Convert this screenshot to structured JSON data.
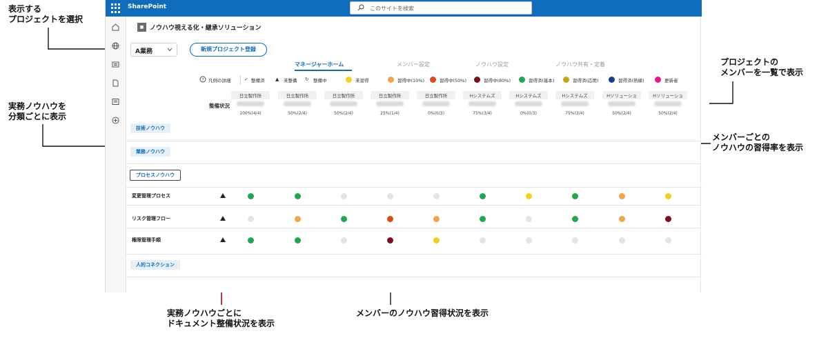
{
  "annotations": {
    "select_project": [
      "表示する",
      "プロジェクトを選択"
    ],
    "classify_knowhow": [
      "実務ノウハウを",
      "分類ごとに表示"
    ],
    "member_list": [
      "プロジェクトの",
      "メンバーを一覧で表示"
    ],
    "member_rate": [
      "メンバーごとの",
      "ノウハウの習得率を表示"
    ],
    "doc_status": [
      "実務ノウハウごとに",
      "ドキュメント整備状況を表示"
    ],
    "member_status": "メンバーのノウハウ習得状況を表示"
  },
  "app": {
    "brand": "SharePoint",
    "search_placeholder": "このサイトを検索",
    "site_title": "ノウハウ視える化・継承ソリューション",
    "site_logo": "■"
  },
  "toolbar": {
    "project_value": "A業務",
    "new_project_label": "新規プロジェクト登録"
  },
  "tabs": [
    {
      "label": "マネージャーホーム",
      "active": true
    },
    {
      "label": "メンバー設定",
      "active": false
    },
    {
      "label": "ノウハウ設定",
      "active": false
    },
    {
      "label": "ノウハウ共有・定着",
      "active": false
    }
  ],
  "legend": {
    "help_label": "凡例の詳細",
    "doc_items": [
      {
        "icon": "check-icon",
        "label": "整備済"
      },
      {
        "icon": "triangle-icon",
        "label": "未整備"
      },
      {
        "icon": "refresh-icon",
        "label": "整備中"
      }
    ],
    "skill_items": [
      {
        "label": "未習得",
        "color": "#f2d21b"
      },
      {
        "label": "習得中(10%)",
        "color": "#f5a34a"
      },
      {
        "label": "習得中(50%)",
        "color": "#d94a14"
      },
      {
        "label": "習得中(80%)",
        "color": "#7a0f23"
      },
      {
        "label": "習得済(基本)",
        "color": "#1ea94c"
      },
      {
        "label": "習得済(応用)",
        "color": "#c8a418"
      },
      {
        "label": "習得済(熟練)",
        "color": "#163f8c"
      },
      {
        "label": "更新者",
        "color": "#e8158c"
      }
    ]
  },
  "matrix": {
    "status_header": "整備状況",
    "members": [
      {
        "org": "日立製作所",
        "rate": "100%(4/4)"
      },
      {
        "org": "日立製作所",
        "rate": "50%(2/4)"
      },
      {
        "org": "日立製作所",
        "rate": "50%(2/4)"
      },
      {
        "org": "日立製作所",
        "rate": "25%(1/4)"
      },
      {
        "org": "日立製作所",
        "rate": "0%(0/3)"
      },
      {
        "org": "Hシステムズ",
        "rate": "75%(3/4)"
      },
      {
        "org": "Hシステムズ",
        "rate": "0%(0/3)"
      },
      {
        "org": "Hシステムズ",
        "rate": "75%(3/4)"
      },
      {
        "org": "Hソリューショ",
        "rate": "50%(2/4)"
      },
      {
        "org": "Hソリューショ",
        "rate": "50%(2/4)"
      }
    ],
    "categories": [
      "技術ノウハウ",
      "業務ノウハウ",
      "プロセスノウハウ",
      "人的コネクション"
    ],
    "rows": [
      {
        "label": "変更管理プロセス",
        "status": "未整備",
        "cells": [
          "#1ea94c",
          "#1ea94c",
          "#e4e4e4",
          "#e4e4e4",
          "#e4e4e4",
          "#1ea94c",
          "#f2d21b",
          "#1ea94c",
          "#f5a34a",
          "#f2d21b"
        ]
      },
      {
        "label": "リスク管理フロー",
        "status": "未整備",
        "cells": [
          "#e4e4e4",
          "#f5a34a",
          "#1ea94c",
          "#d94a14",
          "#f5a34a",
          "#1ea94c",
          "#e4e4e4",
          "#1ea94c",
          "#f5a34a",
          "#7a0f23"
        ]
      },
      {
        "label": "権限管理手順",
        "status": "未整備",
        "cells": [
          "#1ea94c",
          "#1ea94c",
          "#e4e4e4",
          "#7a0f23",
          "#f2d21b",
          "#e4e4e4",
          "#e4e4e4",
          "#e4e4e4",
          "#e4e4e4",
          "#e4e4e4"
        ]
      }
    ]
  }
}
